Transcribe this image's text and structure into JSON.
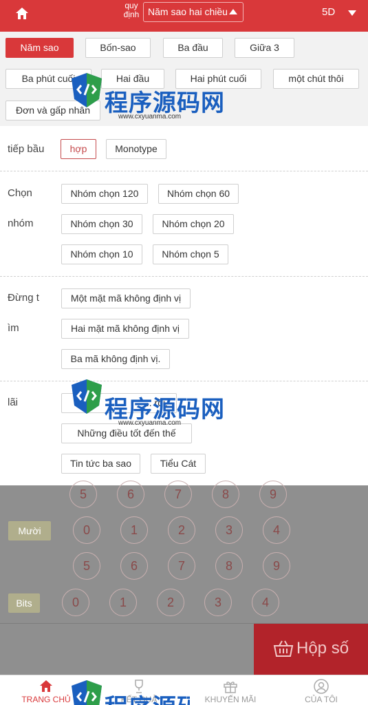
{
  "header": {
    "rule_label": "quy định",
    "rule_value": "Năm sao hai chiều",
    "period": "5D"
  },
  "tabs": [
    {
      "label": "Năm sao"
    },
    {
      "label": "Bốn-sao"
    },
    {
      "label": "Ba đầu"
    },
    {
      "label": "Giữa 3"
    },
    {
      "label": "Ba phút cuối"
    },
    {
      "label": "Hai đầu"
    },
    {
      "label": "Hai phút cuối"
    },
    {
      "label": "một chút thôi"
    },
    {
      "label": "Đơn và gấp nhân"
    }
  ],
  "sections": {
    "direct": {
      "label": "tiếp bầu",
      "options": [
        "hợp",
        "Monotype"
      ]
    },
    "group": {
      "label_line1": "Chọn",
      "label_line2": "nhóm",
      "options": [
        "Nhóm chọn 120",
        "Nhóm chọn 60",
        "Nhóm chọn 30",
        "Nhóm chọn 20",
        "Nhóm chọn 10",
        "Nhóm chọn 5"
      ]
    },
    "fixed": {
      "label_line1": "Đừng t",
      "label_line2": "ìm",
      "options": [
        "Một mặt mã không định vị",
        "Hai mặt mã không định vị",
        "Ba mã không định vị."
      ]
    },
    "interest": {
      "label": "lãi",
      "options": [
        "... rồi.",
        "Những điều tốt đến thế",
        "Tin tức ba sao",
        "Tiểu Cát"
      ]
    }
  },
  "board": {
    "row_top_numbers": [
      "5",
      "6",
      "7",
      "8",
      "9"
    ],
    "rows": [
      {
        "tag": "Mười",
        "numbers_a": [
          "0",
          "1",
          "2",
          "3",
          "4"
        ],
        "numbers_b": [
          "5",
          "6",
          "7",
          "8",
          "9"
        ]
      },
      {
        "tag": "Bits",
        "numbers_a": [
          "0",
          "1",
          "2",
          "3",
          "4"
        ]
      }
    ]
  },
  "cart": {
    "label": "Hộp số"
  },
  "bottom_nav": [
    {
      "label": "TRANG CHỦ"
    },
    {
      "label": "KẾT QUẢ"
    },
    {
      "label": "KHUYẾN MÃI"
    },
    {
      "label": "CỦA TÔI"
    }
  ],
  "watermark": {
    "title": "程序源码网",
    "url": "www.cxyuanma.com"
  },
  "colors": {
    "accent": "#d9383a",
    "cart": "#b2232a",
    "overlay": "#8f8f8f"
  }
}
